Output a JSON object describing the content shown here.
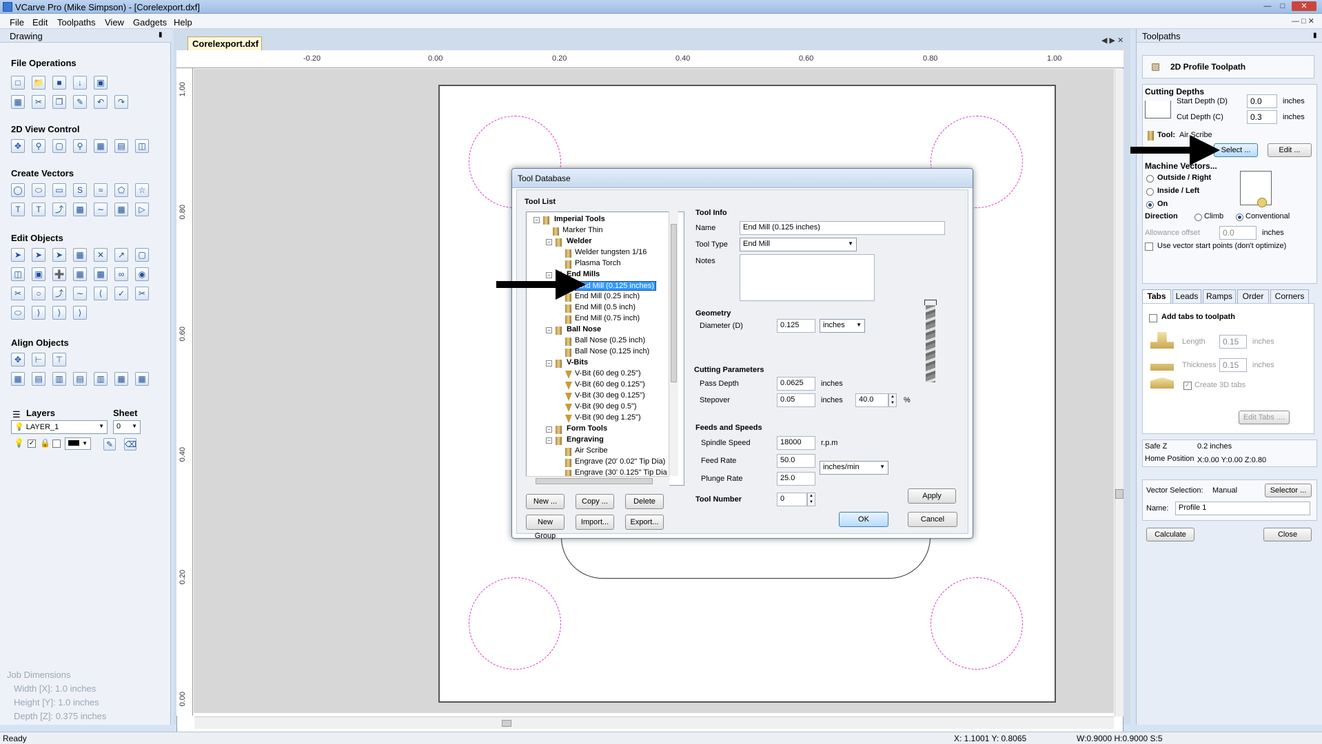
{
  "window": {
    "title": "VCarve Pro (Mike Simpson) - [Corelexport.dxf]"
  },
  "menu": [
    "File",
    "Edit",
    "Toolpaths",
    "View",
    "Gadgets",
    "Help"
  ],
  "left_panel": {
    "title": "Drawing",
    "sections": {
      "file_ops": "File Operations",
      "view_control": "2D View Control",
      "create_vectors": "Create Vectors",
      "edit_objects": "Edit Objects",
      "align_objects": "Align Objects",
      "layers": "Layers",
      "sheet": "Sheet"
    },
    "layer_value": "LAYER_1",
    "sheet_value": "0",
    "job_dimensions": {
      "title": "Job Dimensions",
      "width": "Width  [X]: 1.0 inches",
      "height": "Height [Y]: 1.0 inches",
      "depth": "Depth  [Z]: 0.375 inches"
    }
  },
  "document": {
    "tab": "Corelexport.dxf",
    "hruler": [
      "-0.20",
      "0.00",
      "0.20",
      "0.40",
      "0.60",
      "0.80",
      "1.00"
    ],
    "vruler": [
      "1.00",
      "0.80",
      "0.60",
      "0.40",
      "0.20",
      "0.00"
    ]
  },
  "dialog": {
    "title": "Tool Database",
    "tool_list_label": "Tool List",
    "tree": [
      {
        "label": "Imperial Tools",
        "group": true,
        "level": 0
      },
      {
        "label": "Marker Thin",
        "level": 1
      },
      {
        "label": "Welder",
        "group": true,
        "level": 1
      },
      {
        "label": "Welder tungsten 1/16",
        "level": 2
      },
      {
        "label": "Plasma Torch",
        "level": 2
      },
      {
        "label": "End Mills",
        "group": true,
        "level": 1
      },
      {
        "label": "End Mill (0.125 inches)",
        "level": 2,
        "selected": true
      },
      {
        "label": "End Mill (0.25 inch)",
        "level": 2
      },
      {
        "label": "End Mill (0.5 inch)",
        "level": 2
      },
      {
        "label": "End Mill (0.75 inch)",
        "level": 2
      },
      {
        "label": "Ball Nose",
        "group": true,
        "level": 1
      },
      {
        "label": "Ball Nose (0.25 inch)",
        "level": 2
      },
      {
        "label": "Ball Nose (0.125 inch)",
        "level": 2
      },
      {
        "label": "V-Bits",
        "group": true,
        "level": 1
      },
      {
        "label": "V-Bit (60 deg 0.25\")",
        "level": 2,
        "vbit": true
      },
      {
        "label": "V-Bit (60 deg 0.125\")",
        "level": 2,
        "vbit": true
      },
      {
        "label": "V-Bit (30 deg 0.125\")",
        "level": 2,
        "vbit": true
      },
      {
        "label": "V-Bit (90 deg 0.5\")",
        "level": 2,
        "vbit": true
      },
      {
        "label": "V-Bit (90 deg 1.25\")",
        "level": 2,
        "vbit": true
      },
      {
        "label": "Form Tools",
        "group": true,
        "level": 1
      },
      {
        "label": "Engraving",
        "group": true,
        "level": 1
      },
      {
        "label": "Air Scribe",
        "level": 2
      },
      {
        "label": "Engrave (20' 0.02\" Tip Dia)",
        "level": 2
      },
      {
        "label": "Engrave (30' 0.125\" Tip Dia",
        "level": 2
      }
    ],
    "buttons": {
      "new": "New ...",
      "copy": "Copy ...",
      "delete": "Delete",
      "new_group": "New Group",
      "import": "Import...",
      "export": "Export...",
      "apply": "Apply",
      "ok": "OK",
      "cancel": "Cancel"
    },
    "tool_info": {
      "section": "Tool Info",
      "name_label": "Name",
      "name": "End Mill (0.125 inches)",
      "type_label": "Tool Type",
      "type": "End Mill",
      "notes_label": "Notes",
      "notes": ""
    },
    "geometry": {
      "section": "Geometry",
      "diameter_label": "Diameter (D)",
      "diameter": "0.125",
      "units": "inches"
    },
    "cutting": {
      "section": "Cutting Parameters",
      "pass_depth_label": "Pass Depth",
      "pass_depth": "0.0625",
      "pass_units": "inches",
      "stepover_label": "Stepover",
      "stepover": "0.05",
      "stepover_units": "inches",
      "stepover_pct": "40.0",
      "pct": "%"
    },
    "feeds": {
      "section": "Feeds and Speeds",
      "spindle_label": "Spindle Speed",
      "spindle": "18000",
      "spindle_units": "r.p.m",
      "feed_label": "Feed Rate",
      "feed": "50.0",
      "plunge_label": "Plunge Rate",
      "plunge": "25.0",
      "rate_units": "inches/min"
    },
    "tool_number": {
      "label": "Tool Number",
      "value": "0"
    }
  },
  "right_panel": {
    "title": "Toolpaths",
    "toolpath_name": "2D Profile Toolpath",
    "cutting_depths": "Cutting Depths",
    "start_depth_label": "Start Depth (D)",
    "start_depth": "0.0",
    "cut_depth_label": "Cut Depth (C)",
    "cut_depth": "0.3",
    "units": "inches",
    "tool_label": "Tool:",
    "tool_name": "Air Scribe",
    "select_btn": "Select ...",
    "edit_btn": "Edit ...",
    "machine_vectors": "Machine Vectors...",
    "outside": "Outside / Right",
    "inside": "Inside / Left",
    "on": "On",
    "direction": "Direction",
    "climb": "Climb",
    "conventional": "Conventional",
    "allowance_label": "Allowance offset",
    "allowance": "0.0",
    "vector_start": "Use vector start points (don't optimize)",
    "tabs": [
      "Tabs",
      "Leads",
      "Ramps",
      "Order",
      "Corners"
    ],
    "add_tabs": "Add tabs to toolpath",
    "length_label": "Length",
    "length": "0.15",
    "thickness_label": "Thickness",
    "thickness": "0.15",
    "create_3d": "Create 3D tabs",
    "edit_tabs": "Edit Tabs ....",
    "safe_z_label": "Safe Z",
    "safe_z": "0.2 inches",
    "home_label": "Home Position",
    "home": "X:0.00 Y:0.00 Z:0.80",
    "vector_sel_label": "Vector Selection:",
    "vector_sel": "Manual",
    "selector_btn": "Selector ...",
    "name_label": "Name:",
    "name": "Profile 1",
    "calculate": "Calculate",
    "close": "Close"
  },
  "status": {
    "left": "Ready",
    "coords": "X: 1.1001 Y: 0.8065",
    "dims": "W:0.9000  H:0.9000  S:5"
  },
  "colors": {
    "accent": "#3399ff",
    "dashed_circle": "#e030c0"
  }
}
